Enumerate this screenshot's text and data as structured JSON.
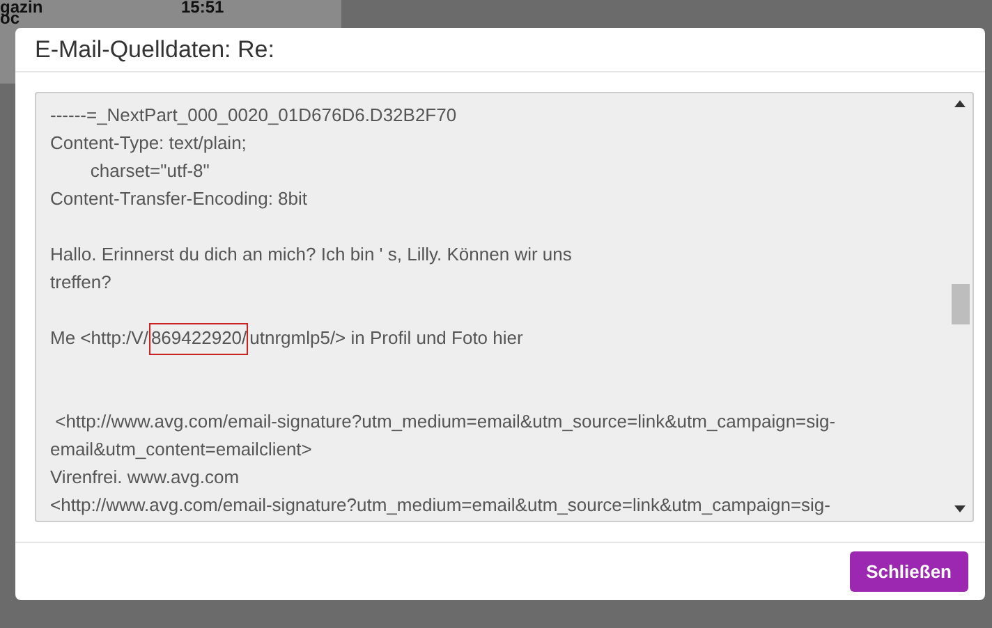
{
  "background": {
    "item_title": "gazin",
    "item_time": "15:51",
    "item_snippet": "oc"
  },
  "dialog": {
    "title": "E-Mail-Quelldaten: Re:",
    "source_lines": [
      {
        "kind": "text",
        "text": "------=_NextPart_000_0020_01D676D6.D32B2F70"
      },
      {
        "kind": "text",
        "text": "Content-Type: text/plain;"
      },
      {
        "kind": "text",
        "text": "\tcharset=\"utf-8\""
      },
      {
        "kind": "text",
        "text": "Content-Transfer-Encoding: 8bit"
      },
      {
        "kind": "blank"
      },
      {
        "kind": "text",
        "text": "Hallo. Erinnerst du dich an mich? Ich bin ' s, Lilly. Können wir uns"
      },
      {
        "kind": "text",
        "text": "treffen?"
      },
      {
        "kind": "blank"
      },
      {
        "kind": "highlight",
        "before": "Me <http:/V/",
        "marked": "869422920/",
        "after": "utnrgmlp5/> in Profil und Foto hier"
      },
      {
        "kind": "blank"
      },
      {
        "kind": "blank"
      },
      {
        "kind": "text",
        "text": " <http://www.avg.com/email-signature?utm_medium=email&utm_source=link&utm_campaign=sig-"
      },
      {
        "kind": "text",
        "text": "email&utm_content=emailclient>"
      },
      {
        "kind": "text",
        "text": "Virenfrei. www.avg.com"
      },
      {
        "kind": "text",
        "text": "<http://www.avg.com/email-signature?utm_medium=email&utm_source=link&utm_campaign=sig-"
      }
    ],
    "close_button": "Schließen"
  }
}
